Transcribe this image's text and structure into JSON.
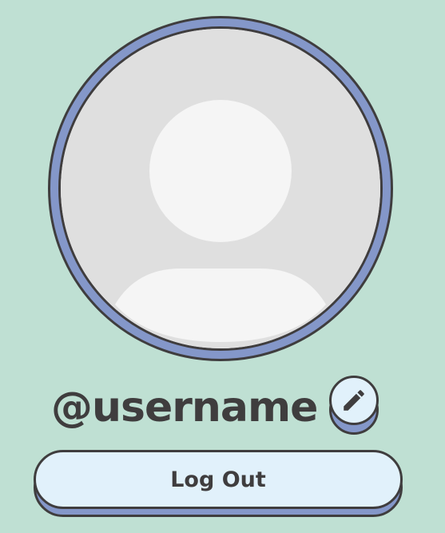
{
  "profile": {
    "username": "@username",
    "avatar_icon": "default-user-avatar-icon",
    "edit_icon": "pencil-icon"
  },
  "actions": {
    "logout_label": "Log Out"
  },
  "colors": {
    "background": "#bfe0d3",
    "ring": "#8497c9",
    "outline": "#3f3d3e",
    "button_fill": "#e1f1fb",
    "avatar_bg": "#dfdfdf",
    "avatar_figure": "#f5f5f5"
  }
}
